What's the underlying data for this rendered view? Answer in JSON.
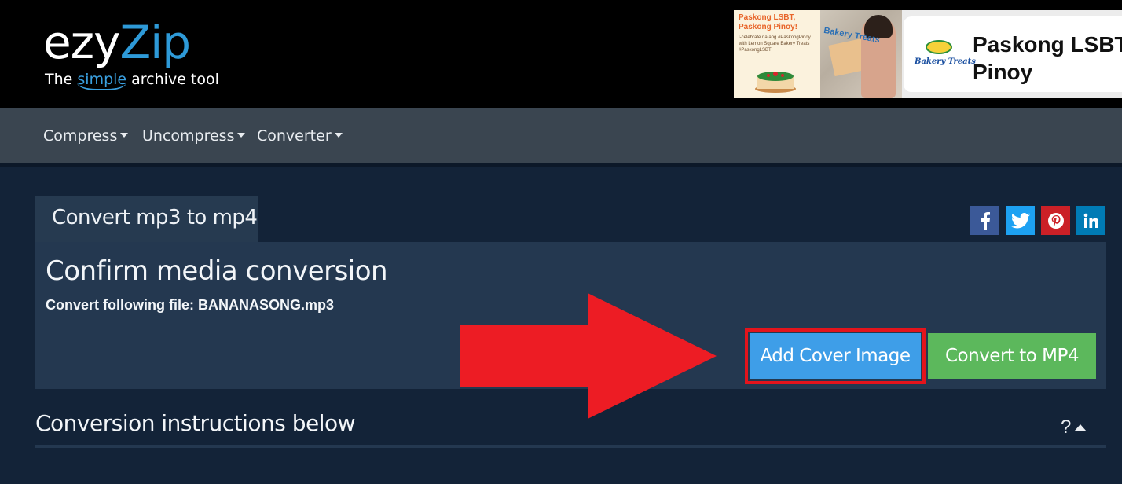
{
  "header": {
    "logo": {
      "part1": "ezy",
      "part2": "Zip"
    },
    "tagline": {
      "before": "The ",
      "highlight": "simple",
      "after": " archive tool"
    }
  },
  "ad": {
    "left_headline": "Paskong LSBT, Paskong Pinoy!",
    "left_subtext": "I-celebrate na ang #PaskongPinoy with Lemon Square Bakery Treats #PaskongLSBT",
    "photo_brand": "Bakery Treats",
    "brand_logo_text": "Bakery Treats",
    "title_line1": "Paskong LSBT,",
    "title_line2": "Pinoy"
  },
  "nav": {
    "items": [
      {
        "label": "Compress"
      },
      {
        "label": "Uncompress"
      },
      {
        "label": "Converter"
      }
    ]
  },
  "tab": {
    "label": "Convert mp3 to mp4"
  },
  "social": [
    {
      "icon": "facebook-icon",
      "color": "#3b5998"
    },
    {
      "icon": "twitter-icon",
      "color": "#1da1f2"
    },
    {
      "icon": "pinterest-icon",
      "color": "#cb2027"
    },
    {
      "icon": "linkedin-icon",
      "color": "#007bb5"
    }
  ],
  "panel": {
    "title": "Confirm media conversion",
    "file_line": "Convert following file: BANANASONG.mp3"
  },
  "buttons": {
    "add_cover": "Add Cover Image",
    "convert": "Convert to MP4"
  },
  "instructions": {
    "title": "Conversion instructions below",
    "toggle": "?"
  },
  "colors": {
    "page_bg": "#132338",
    "panel_bg": "#243850",
    "navbar_bg": "#3a4550",
    "accent_blue": "#3e9ee8",
    "accent_green": "#5cb85c",
    "highlight_red": "#e4141c"
  }
}
